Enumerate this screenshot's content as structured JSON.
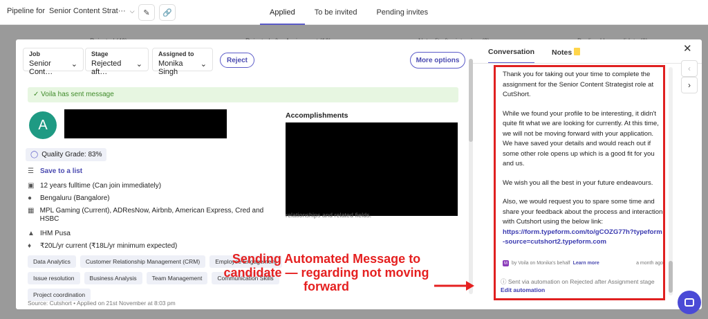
{
  "topbar": {
    "pipeline_prefix": "Pipeline for",
    "pipeline_name": "Senior Content Strat···",
    "tabs": [
      "Applied",
      "To be invited",
      "Pending invites"
    ]
  },
  "background": {
    "columns": [
      "Rejected (40)",
      "Rejected after Assignment (16)",
      "Not a fit after interview (2)",
      "Declined by candidate (0)"
    ]
  },
  "candidate": {
    "selectors": {
      "job_label": "Job",
      "job_value": "Senior Cont…",
      "stage_label": "Stage",
      "stage_value": "Rejected aft…",
      "assigned_label": "Assigned to",
      "assigned_value": "Monika Singh"
    },
    "reject_label": "Reject",
    "more_options_label": "More options",
    "sent_banner": "Voila has sent message",
    "avatar_initial": "A",
    "quality_grade": "Quality Grade: 83%",
    "save_label": "Save to a list",
    "experience": "12 years fulltime (Can join immediately)",
    "location": "Bengaluru (Bangalore)",
    "companies": "MPL Gaming (Current), ADResNow, Airbnb, American Express, Cred and HSBC",
    "education": "IHM Pusa",
    "salary": "₹20L/yr current (₹18L/yr minimum expected)",
    "skills": [
      "Data Analytics",
      "Customer Relationship Management (CRM)",
      "Employee Engagement",
      "Issue resolution",
      "Business Analysis",
      "Team Management",
      "Communication Skills",
      "Project coordination"
    ],
    "source": "Source: Cutshort  •  Applied on 21st November at 8:03 pm",
    "accomplishments_title": "Accomplishments",
    "accomplishments_tail": "relationships and related fields."
  },
  "conversation": {
    "tabs": [
      "Conversation",
      "Notes"
    ],
    "paragraphs": [
      "Thank you for taking out your time to complete the assignment for the Senior Content Strategist role at CutShort.",
      "While we found your profile to be interesting, it didn't quite fit what we are looking for currently. At this time, we will not be moving forward with your application. We have saved your details and would reach out if some other role opens up which is a good fit for you and us.",
      "We wish you all the best in your future endeavours.",
      "Also, we would request you to spare some time and share your feedback about the process and interaction with Cutshort using the below link:"
    ],
    "link": "https://form.typeform.com/to/gCOZG77h?typeform-source=cutshort2.typeform.com",
    "meta_by": "by Voila on Monika's behalf",
    "meta_learn": "Learn more",
    "meta_time": "a month ago",
    "automation_text": "Sent via automation on Rejected after Assignment stage",
    "edit_automation": "Edit automation"
  },
  "annotation": {
    "text": "Sending Automated Message to candidate — regarding not moving forward",
    "color": "#e52020"
  },
  "colors": {
    "accent": "#5a5ac8",
    "success_bg": "#e7f6e1",
    "avatar": "#1f9a83"
  }
}
